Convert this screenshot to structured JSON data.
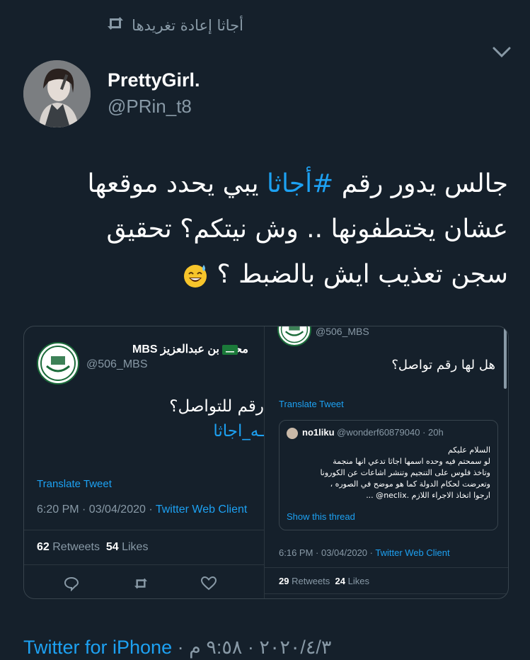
{
  "retweet_header": {
    "text": "أجاثا إعادة تغريدها"
  },
  "author": {
    "name": "PrettyGirl.",
    "handle": "@PRin_t8"
  },
  "tweet": {
    "line1_before": "جالس يدور رقم ",
    "hashtag": "#أجاثا",
    "line1_after": " يبي يحدد موقعها",
    "line2": "عشان يختطفونها .. وش نيتكم؟ تحقيق",
    "line3": "سجن تعذيب ايش بالضبط ؟"
  },
  "embedded_left": {
    "name": "محمد بن عبدالعزيز MBS",
    "handle": "@506_MBS",
    "text_line1": "رقم للتواصل؟",
    "text_line2": "ـه_اجاثا",
    "translate": "Translate Tweet",
    "time_date": "6:20 PM · 03/04/2020 · ",
    "client": "Twitter Web Client",
    "retweets_count": "62",
    "retweets_label": "Retweets",
    "likes_count": "54",
    "likes_label": "Likes"
  },
  "embedded_right": {
    "handle": "@506_MBS",
    "text": "هل لها رقم تواصل؟",
    "translate": "Translate Tweet",
    "quoted": {
      "name": "no1liku",
      "handle": "@wonderf60879040",
      "time": "· 20h",
      "lines": [
        "السلام عليكم",
        "لو سمحتم فيه وحده اسمها اجاثا تدعي انها منجمة",
        "وتاخذ فلوس على التنجيم وتنشر اشاعات عن الكورونا",
        "وتعرضت لحكام الدولة كما هو موضح في الصوره ،",
        "ارجوا اتخاذ الاجراء اللازم .neclix@ ..."
      ],
      "show_thread": "Show this thread"
    },
    "time_date": "6:16 PM · 03/04/2020 · ",
    "client": "Twitter Web Client",
    "retweets_count": "29",
    "retweets_label": "Retweets",
    "likes_count": "24",
    "likes_label": "Likes"
  },
  "footer": {
    "client": "Twitter for iPhone",
    "timestamp": " · ٢٠٢٠/٤/٣ · ٩:٥٨ م"
  },
  "colors": {
    "background": "#15202b",
    "accent": "#1da1f2",
    "muted": "#8899a6",
    "border": "#38444d"
  },
  "icons": [
    "retweet-icon",
    "chevron-down-icon",
    "sweat-smile-emoji",
    "saudi-flag-icon",
    "reply-icon",
    "like-icon"
  ]
}
